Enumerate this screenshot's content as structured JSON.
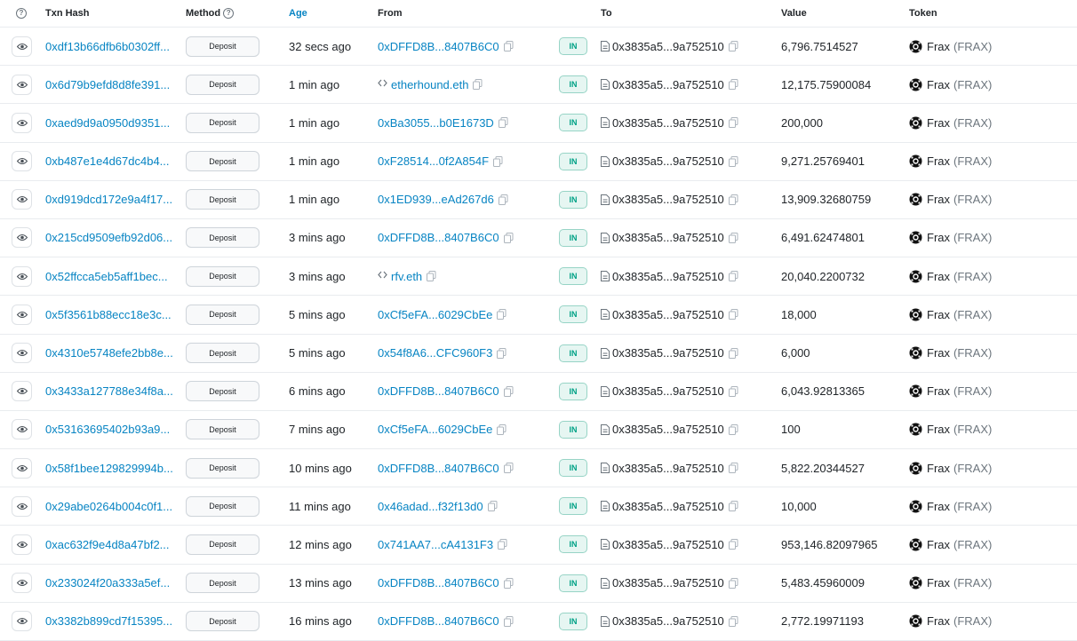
{
  "headers": {
    "txn_hash": "Txn Hash",
    "method": "Method",
    "age": "Age",
    "from": "From",
    "to": "To",
    "value": "Value",
    "token": "Token"
  },
  "rows": [
    {
      "hash": "0xdf13b66dfb6b0302ff...",
      "method": "Deposit",
      "age": "32 secs ago",
      "from": "0xDFFD8B...8407B6C0",
      "from_ens": false,
      "direction": "IN",
      "to": "0x3835a5...9a752510",
      "value": "6,796.7514527",
      "token": "Frax",
      "token_symbol": "(FRAX)"
    },
    {
      "hash": "0x6d79b9efd8d8fe391...",
      "method": "Deposit",
      "age": "1 min ago",
      "from": "etherhound.eth",
      "from_ens": true,
      "direction": "IN",
      "to": "0x3835a5...9a752510",
      "value": "12,175.75900084",
      "token": "Frax",
      "token_symbol": "(FRAX)"
    },
    {
      "hash": "0xaed9d9a0950d9351...",
      "method": "Deposit",
      "age": "1 min ago",
      "from": "0xBa3055...b0E1673D",
      "from_ens": false,
      "direction": "IN",
      "to": "0x3835a5...9a752510",
      "value": "200,000",
      "token": "Frax",
      "token_symbol": "(FRAX)"
    },
    {
      "hash": "0xb487e1e4d67dc4b4...",
      "method": "Deposit",
      "age": "1 min ago",
      "from": "0xF28514...0f2A854F",
      "from_ens": false,
      "direction": "IN",
      "to": "0x3835a5...9a752510",
      "value": "9,271.25769401",
      "token": "Frax",
      "token_symbol": "(FRAX)"
    },
    {
      "hash": "0xd919dcd172e9a4f17...",
      "method": "Deposit",
      "age": "1 min ago",
      "from": "0x1ED939...eAd267d6",
      "from_ens": false,
      "direction": "IN",
      "to": "0x3835a5...9a752510",
      "value": "13,909.32680759",
      "token": "Frax",
      "token_symbol": "(FRAX)"
    },
    {
      "hash": "0x215cd9509efb92d06...",
      "method": "Deposit",
      "age": "3 mins ago",
      "from": "0xDFFD8B...8407B6C0",
      "from_ens": false,
      "direction": "IN",
      "to": "0x3835a5...9a752510",
      "value": "6,491.62474801",
      "token": "Frax",
      "token_symbol": "(FRAX)"
    },
    {
      "hash": "0x52ffcca5eb5aff1bec...",
      "method": "Deposit",
      "age": "3 mins ago",
      "from": "rfv.eth",
      "from_ens": true,
      "direction": "IN",
      "to": "0x3835a5...9a752510",
      "value": "20,040.2200732",
      "token": "Frax",
      "token_symbol": "(FRAX)"
    },
    {
      "hash": "0x5f3561b88ecc18e3c...",
      "method": "Deposit",
      "age": "5 mins ago",
      "from": "0xCf5eFA...6029CbEe",
      "from_ens": false,
      "direction": "IN",
      "to": "0x3835a5...9a752510",
      "value": "18,000",
      "token": "Frax",
      "token_symbol": "(FRAX)"
    },
    {
      "hash": "0x4310e5748efe2bb8e...",
      "method": "Deposit",
      "age": "5 mins ago",
      "from": "0x54f8A6...CFC960F3",
      "from_ens": false,
      "direction": "IN",
      "to": "0x3835a5...9a752510",
      "value": "6,000",
      "token": "Frax",
      "token_symbol": "(FRAX)"
    },
    {
      "hash": "0x3433a127788e34f8a...",
      "method": "Deposit",
      "age": "6 mins ago",
      "from": "0xDFFD8B...8407B6C0",
      "from_ens": false,
      "direction": "IN",
      "to": "0x3835a5...9a752510",
      "value": "6,043.92813365",
      "token": "Frax",
      "token_symbol": "(FRAX)"
    },
    {
      "hash": "0x53163695402b93a9...",
      "method": "Deposit",
      "age": "7 mins ago",
      "from": "0xCf5eFA...6029CbEe",
      "from_ens": false,
      "direction": "IN",
      "to": "0x3835a5...9a752510",
      "value": "100",
      "token": "Frax",
      "token_symbol": "(FRAX)"
    },
    {
      "hash": "0x58f1bee129829994b...",
      "method": "Deposit",
      "age": "10 mins ago",
      "from": "0xDFFD8B...8407B6C0",
      "from_ens": false,
      "direction": "IN",
      "to": "0x3835a5...9a752510",
      "value": "5,822.20344527",
      "token": "Frax",
      "token_symbol": "(FRAX)"
    },
    {
      "hash": "0x29abe0264b004c0f1...",
      "method": "Deposit",
      "age": "11 mins ago",
      "from": "0x46adad...f32f13d0",
      "from_ens": false,
      "direction": "IN",
      "to": "0x3835a5...9a752510",
      "value": "10,000",
      "token": "Frax",
      "token_symbol": "(FRAX)"
    },
    {
      "hash": "0xac632f9e4d8a47bf2...",
      "method": "Deposit",
      "age": "12 mins ago",
      "from": "0x741AA7...cA4131F3",
      "from_ens": false,
      "direction": "IN",
      "to": "0x3835a5...9a752510",
      "value": "953,146.82097965",
      "token": "Frax",
      "token_symbol": "(FRAX)"
    },
    {
      "hash": "0x233024f20a333a5ef...",
      "method": "Deposit",
      "age": "13 mins ago",
      "from": "0xDFFD8B...8407B6C0",
      "from_ens": false,
      "direction": "IN",
      "to": "0x3835a5...9a752510",
      "value": "5,483.45960009",
      "token": "Frax",
      "token_symbol": "(FRAX)"
    },
    {
      "hash": "0x3382b899cd7f15395...",
      "method": "Deposit",
      "age": "16 mins ago",
      "from": "0xDFFD8B...8407B6C0",
      "from_ens": false,
      "direction": "IN",
      "to": "0x3835a5...9a752510",
      "value": "2,772.19971193",
      "token": "Frax",
      "token_symbol": "(FRAX)"
    }
  ],
  "colors": {
    "link": "#0784c3",
    "in_badge_bg": "#e6f6f2",
    "in_badge_text": "#00a186",
    "border": "#e9ecef"
  },
  "icons": {
    "header_info": "question-circle-icon",
    "row_view": "eye-icon",
    "copy": "copy-icon",
    "contract": "document-icon",
    "ens": "code-brackets-icon",
    "token": "frax-logo-icon"
  }
}
